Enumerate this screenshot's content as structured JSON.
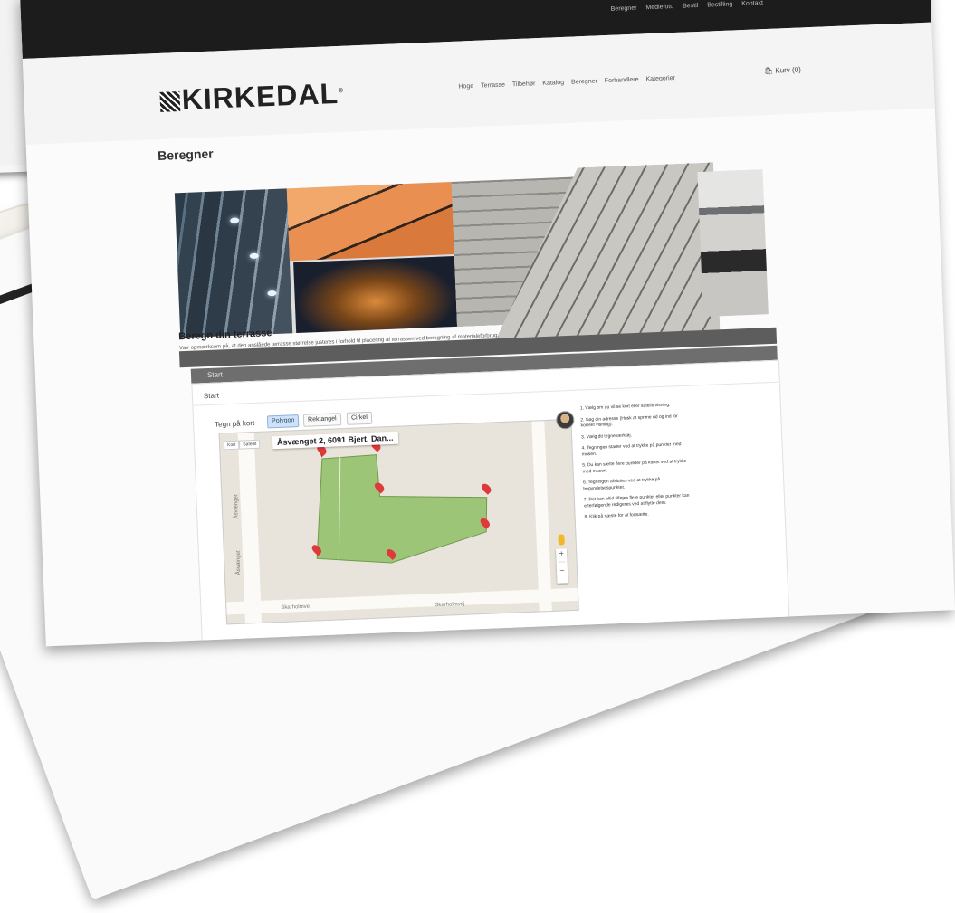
{
  "topbar": {
    "links": [
      "Beregner",
      "Mediefoto",
      "Bestil",
      "Bestilling",
      "Kontakt"
    ]
  },
  "header": {
    "logo": "KIRKEDAL",
    "nav": [
      "Hoge",
      "Terrasse",
      "Tilbehør",
      "Katalog",
      "Beregner",
      "Forhandlere",
      "Kategorier"
    ],
    "cart": "Kurv (0)"
  },
  "page": {
    "title": "Beregner"
  },
  "section": {
    "title": "Beregn din terrasse",
    "description": "Vær opmærksom på, at den anslåede terrasse størrelse justeres i forhold til placering af terrassen ved beregning af materialeforbrug."
  },
  "step": {
    "header": "Start",
    "row": "Start"
  },
  "map": {
    "draw_label": "Tegn på kort",
    "tools": [
      "Polygon",
      "Rektangel",
      "Cirkel"
    ],
    "address": "Åsvænget 2, 6091 Bjert, Dan...",
    "map_types": [
      "Kort",
      "Satellit"
    ],
    "streets": [
      "Åsvænget",
      "Åsvænget",
      "Skarholmvej",
      "Skarholmvej"
    ],
    "zoom_in": "+",
    "zoom_out": "−"
  },
  "instructions": [
    "1. Vælg om du vil se kort eller satellit visning.",
    "2. Søg din adresse (Husk at sprime ud og ind for korrekt visning).",
    "3. Vælg dit tegneværktøj.",
    "4. Tegningen starter ved at trykke på punkter med musen.",
    "5. Du kan sætte flere punkter på kortet ved at trykke med musen.",
    "6. Tegningen afsluttes ved at trykke på begyndelsespunktet.",
    "7. Det kan altid tilføjes flere punkter eller punkter kan efterfølgende redigeres ved at flytte dem.",
    "8. Klik på næste for at fortsætte."
  ],
  "colors": {
    "polygon_fill": "#93c16b",
    "marker": "#e0393b",
    "active_tool": "#cfe2f7"
  },
  "icons": {
    "cart": "shopping-bag-icon",
    "marker": "map-pin-icon",
    "pegman": "street-view-icon"
  }
}
